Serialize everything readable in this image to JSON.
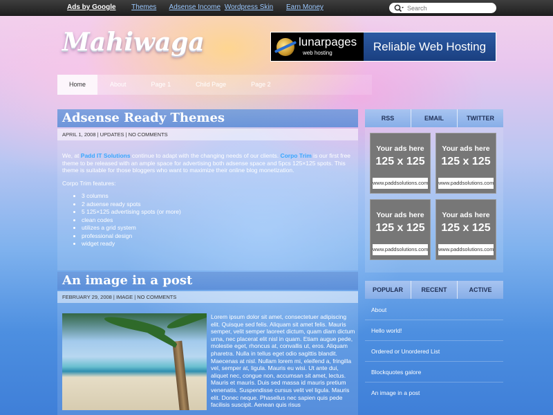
{
  "topbar": {
    "links": [
      "Ads by Google",
      "Themes",
      "Adsense Income",
      "Wordpress Skin",
      "Earn Money"
    ],
    "search_placeholder": "Search"
  },
  "logo": "Mahiwaga",
  "banner": {
    "brand": "lunarpages",
    "brand_sub": "web hosting",
    "text": "Reliable Web Hosting"
  },
  "nav": [
    "Home",
    "About",
    "Page 1",
    "Child Page",
    "Page 2"
  ],
  "posts": [
    {
      "title": "Adsense Ready Themes",
      "meta": "April 1, 2008 | Updates | No Comments",
      "intro_pre": "We, at ",
      "intro_link1": "Padd IT Solutions",
      "intro_mid": " continue to adapt with the changing needs of our clients. ",
      "intro_link2": "Corpo Trim",
      "intro_post": " is our first free theme to be released with an ample space for advertising both adsense space and 5pcs 125×125 spots. This theme is suitable for those bloggers who want to maximize their online blog monetization.",
      "features_label": "Corpo Trim features:",
      "features": [
        "3 columns",
        "2 adsense ready spots",
        "5 125×125 advertising spots (or more)",
        "clean codes",
        "utilizes a grid system",
        "professional design",
        "widget ready"
      ]
    },
    {
      "title": "An image in a post",
      "meta": "February 29, 2008 | Image | No Comments",
      "body": "Lorem ipsum dolor sit amet, consectetuer adipiscing elit. Quisque sed felis. Aliquam sit amet felis. Mauris semper, velit semper laoreet dictum, quam diam dictum urna, nec placerat elit nisl in quam. Etiam augue pede, molestie eget, rhoncus at, convallis ut, eros. Aliquam pharetra. Nulla in tellus eget odio sagittis blandit. Maecenas at nisl. Nullam lorem mi, eleifend a, fringilla vel, semper at, ligula. Mauris eu wisi. Ut ante dui, aliquet nec, congue non, accumsan sit amet, lectus. Mauris et mauris. Duis sed massa id mauris pretium venenatis. Suspendisse cursus velit vel ligula. Mauris elit. Donec neque. Phasellus nec sapien quis pede facilisis suscipit. Aenean quis risus"
    }
  ],
  "sidebar": {
    "social_tabs": [
      "RSS",
      "EMAIL",
      "TWITTER"
    ],
    "ads": [
      {
        "line1": "Your ads here",
        "line2": "125 x 125",
        "url": "www.paddsolutions.com"
      },
      {
        "line1": "Your ads here",
        "line2": "125 x 125",
        "url": "www.paddsolutions.com"
      },
      {
        "line1": "Your ads here",
        "line2": "125 x 125",
        "url": "www.paddsolutions.com"
      },
      {
        "line1": "Your ads here",
        "line2": "125 x 125",
        "url": "www.paddsolutions.com"
      }
    ],
    "list_tabs": [
      "POPULAR",
      "RECENT",
      "ACTIVE"
    ],
    "list_items": [
      "About",
      "Hello world!",
      "Ordered or Unordered List",
      "Blockquotes galore",
      "An image in a post"
    ]
  }
}
